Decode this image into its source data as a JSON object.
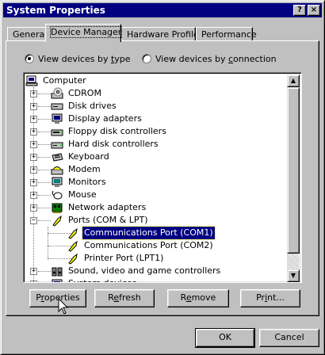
{
  "window": {
    "title": "System Properties",
    "help_glyph": "?",
    "close_glyph": "×"
  },
  "tabs": [
    "General",
    "Device Manager",
    "Hardware Profiles",
    "Performance"
  ],
  "view_options": {
    "by_type_label_pre": "View devices by ",
    "by_type_label_key": "t",
    "by_type_label_post": "ype",
    "by_connection_label_pre": "View devices by ",
    "by_connection_label_key": "c",
    "by_connection_label_post": "onnection",
    "selected": "by_type"
  },
  "tree": {
    "items": [
      {
        "label": "Computer",
        "icon": "computer-icon",
        "level": 0
      },
      {
        "label": "CDROM",
        "icon": "cdrom-icon",
        "level": 1,
        "expander": "+"
      },
      {
        "label": "Disk drives",
        "icon": "disk-drive-icon",
        "level": 1,
        "expander": "+"
      },
      {
        "label": "Display adapters",
        "icon": "display-adapter-icon",
        "level": 1,
        "expander": "+"
      },
      {
        "label": "Floppy disk controllers",
        "icon": "floppy-controller-icon",
        "level": 1,
        "expander": "+"
      },
      {
        "label": "Hard disk controllers",
        "icon": "hard-disk-controller-icon",
        "level": 1,
        "expander": "+"
      },
      {
        "label": "Keyboard",
        "icon": "keyboard-icon",
        "level": 1,
        "expander": "+"
      },
      {
        "label": "Modem",
        "icon": "modem-icon",
        "level": 1,
        "expander": "+"
      },
      {
        "label": "Monitors",
        "icon": "monitor-icon",
        "level": 1,
        "expander": "+"
      },
      {
        "label": "Mouse",
        "icon": "mouse-icon",
        "level": 1,
        "expander": "+"
      },
      {
        "label": "Network adapters",
        "icon": "network-adapter-icon",
        "level": 1,
        "expander": "+"
      },
      {
        "label": "Ports (COM & LPT)",
        "icon": "port-icon",
        "level": 1,
        "expander": "−"
      },
      {
        "label": "Communications Port (COM1)",
        "icon": "port-icon",
        "level": 2,
        "selected": true
      },
      {
        "label": "Communications Port (COM2)",
        "icon": "port-icon",
        "level": 2
      },
      {
        "label": "Printer Port (LPT1)",
        "icon": "port-icon",
        "level": 2
      },
      {
        "label": "Sound, video and game controllers",
        "icon": "sound-controller-icon",
        "level": 1,
        "expander": "+"
      },
      {
        "label": "System devices",
        "icon": "system-devices-icon",
        "level": 1,
        "expander": "+"
      }
    ]
  },
  "action_buttons": {
    "properties_pre": "P",
    "properties_key": "r",
    "properties_post": "operties",
    "refresh_pre": "R",
    "refresh_key": "e",
    "refresh_post": "fresh",
    "remove_pre": "R",
    "remove_key": "e",
    "remove_post": "move",
    "print_pre": "Pr",
    "print_key": "i",
    "print_post": "nt..."
  },
  "dialog_buttons": {
    "ok": "OK",
    "cancel": "Cancel"
  },
  "colors": {
    "selection": "#000080",
    "face": "#c0c0c0",
    "titlebar": "#000080"
  }
}
